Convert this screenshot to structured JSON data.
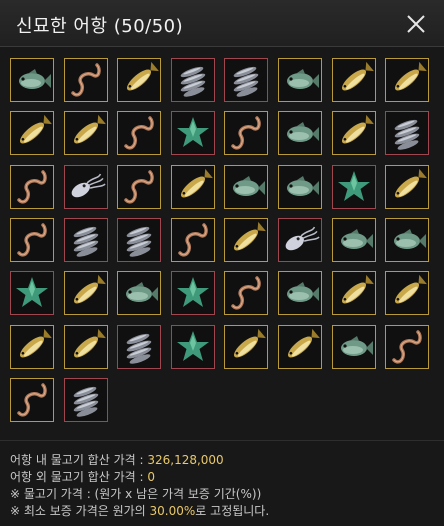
{
  "window": {
    "title": "신묘한 어항 (50/50)",
    "close_icon": "close-icon"
  },
  "colors": {
    "gold_border": "#b89a3a",
    "red_border": "#a0464e",
    "value_text": "#e8c86a"
  },
  "slots": [
    {
      "item": "green-fish",
      "grade": "gold"
    },
    {
      "item": "worm",
      "grade": "gold"
    },
    {
      "item": "yellow-fish",
      "grade": "gold"
    },
    {
      "item": "sardines",
      "grade": "red"
    },
    {
      "item": "sardines",
      "grade": "red"
    },
    {
      "item": "green-fish",
      "grade": "gold"
    },
    {
      "item": "yellow-fish",
      "grade": "gold"
    },
    {
      "item": "yellow-fish",
      "grade": "gold"
    },
    {
      "item": "yellow-fish",
      "grade": "gold"
    },
    {
      "item": "yellow-fish",
      "grade": "gold"
    },
    {
      "item": "worm",
      "grade": "gold"
    },
    {
      "item": "starfish",
      "grade": "red"
    },
    {
      "item": "worm",
      "grade": "gold"
    },
    {
      "item": "green-fish",
      "grade": "gold"
    },
    {
      "item": "yellow-fish",
      "grade": "gold"
    },
    {
      "item": "sardines",
      "grade": "red"
    },
    {
      "item": "worm",
      "grade": "gold"
    },
    {
      "item": "squid",
      "grade": "red"
    },
    {
      "item": "worm",
      "grade": "gold"
    },
    {
      "item": "yellow-fish",
      "grade": "gold"
    },
    {
      "item": "green-fish",
      "grade": "gold"
    },
    {
      "item": "green-fish",
      "grade": "gold"
    },
    {
      "item": "starfish",
      "grade": "red"
    },
    {
      "item": "yellow-fish",
      "grade": "gold"
    },
    {
      "item": "worm",
      "grade": "gold"
    },
    {
      "item": "sardines",
      "grade": "red"
    },
    {
      "item": "sardines",
      "grade": "red"
    },
    {
      "item": "worm",
      "grade": "gold"
    },
    {
      "item": "yellow-fish",
      "grade": "gold"
    },
    {
      "item": "squid",
      "grade": "red"
    },
    {
      "item": "green-fish",
      "grade": "gold"
    },
    {
      "item": "green-fish",
      "grade": "gold"
    },
    {
      "item": "starfish",
      "grade": "red"
    },
    {
      "item": "yellow-fish",
      "grade": "gold"
    },
    {
      "item": "green-fish",
      "grade": "gold"
    },
    {
      "item": "starfish",
      "grade": "red"
    },
    {
      "item": "worm",
      "grade": "gold"
    },
    {
      "item": "green-fish",
      "grade": "gold"
    },
    {
      "item": "yellow-fish",
      "grade": "gold"
    },
    {
      "item": "yellow-fish",
      "grade": "gold"
    },
    {
      "item": "yellow-fish",
      "grade": "gold"
    },
    {
      "item": "yellow-fish",
      "grade": "gold"
    },
    {
      "item": "sardines",
      "grade": "red"
    },
    {
      "item": "starfish",
      "grade": "red"
    },
    {
      "item": "yellow-fish",
      "grade": "gold"
    },
    {
      "item": "yellow-fish",
      "grade": "gold"
    },
    {
      "item": "green-fish",
      "grade": "gold"
    },
    {
      "item": "worm",
      "grade": "gold"
    },
    {
      "item": "worm",
      "grade": "gold"
    },
    {
      "item": "sardines",
      "grade": "red"
    }
  ],
  "info": {
    "inside_label": "어항 내 물고기 합산 가격 : ",
    "inside_value": "326,128,000",
    "outside_label": "어항 외 물고기 합산 가격 : ",
    "outside_value": "0",
    "formula": "※ 물고기 가격 : (원가 x 남은 가격 보증 기간(%))",
    "min_prefix": "※ 최소 보증 가격은 원가의 ",
    "min_percent": "30.00%",
    "min_suffix": "로 고정됩니다."
  }
}
